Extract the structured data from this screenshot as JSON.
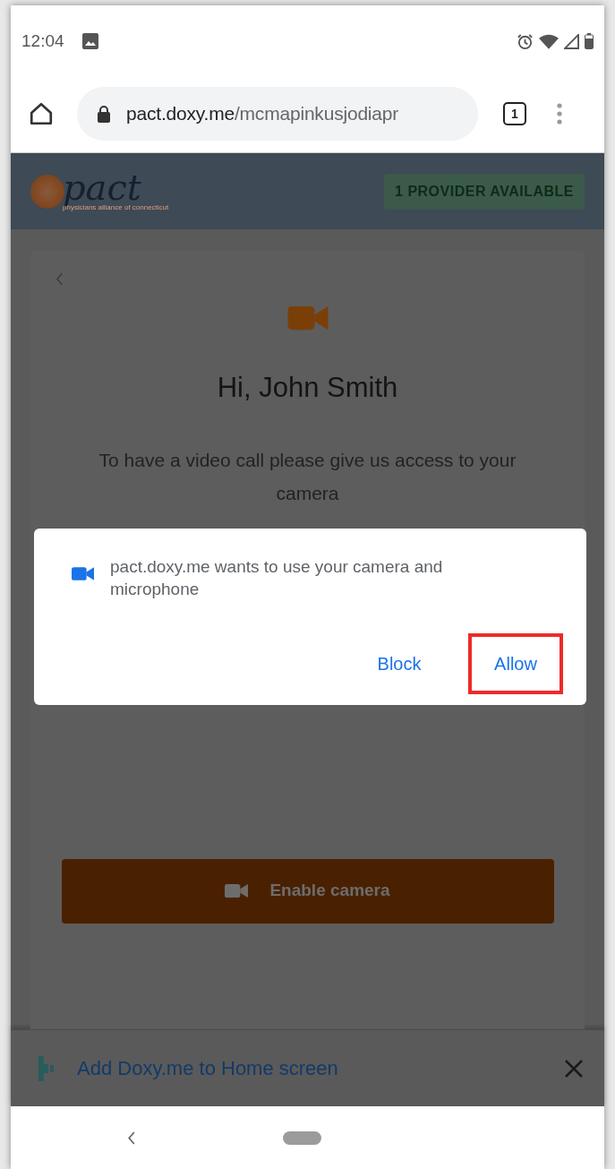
{
  "status_bar": {
    "time": "12:04"
  },
  "browser": {
    "url_host": "pact.doxy.me",
    "url_path": "/mcmapinkusjodiapr",
    "tab_count": "1"
  },
  "site_header": {
    "logo_text": "pact",
    "logo_tagline": "physicians alliance of connecticut",
    "provider_badge": "1 PROVIDER AVAILABLE"
  },
  "card": {
    "greeting": "Hi, John Smith",
    "message": "To have a video call please give us access to your camera",
    "button": "Enable camera"
  },
  "permission_dialog": {
    "message": "pact.doxy.me wants to use your camera and microphone",
    "buttons": [
      {
        "label": "Block",
        "highlighted": false
      },
      {
        "label": "Allow",
        "highlighted": true
      }
    ]
  },
  "install_banner": {
    "text": "Add Doxy.me to Home screen"
  }
}
